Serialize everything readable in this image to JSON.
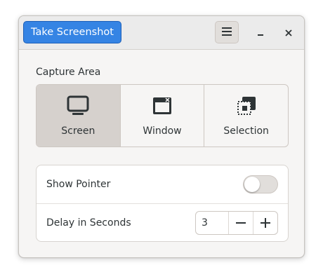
{
  "header": {
    "take_screenshot": "Take Screenshot",
    "menu_icon": "hamburger-menu-icon",
    "minimize_icon": "minimize-icon",
    "close_icon": "close-icon"
  },
  "capture": {
    "section_label": "Capture Area",
    "modes": [
      {
        "label": "Screen",
        "icon": "monitor-icon",
        "selected": true
      },
      {
        "label": "Window",
        "icon": "window-icon",
        "selected": false
      },
      {
        "label": "Selection",
        "icon": "selection-icon",
        "selected": false
      }
    ]
  },
  "options": {
    "show_pointer_label": "Show Pointer",
    "show_pointer_enabled": false,
    "delay_label": "Delay in Seconds",
    "delay_value": "3"
  },
  "colors": {
    "accent": "#3584e4",
    "window_bg": "#f6f5f4",
    "selected_bg": "#d6d1cd"
  }
}
